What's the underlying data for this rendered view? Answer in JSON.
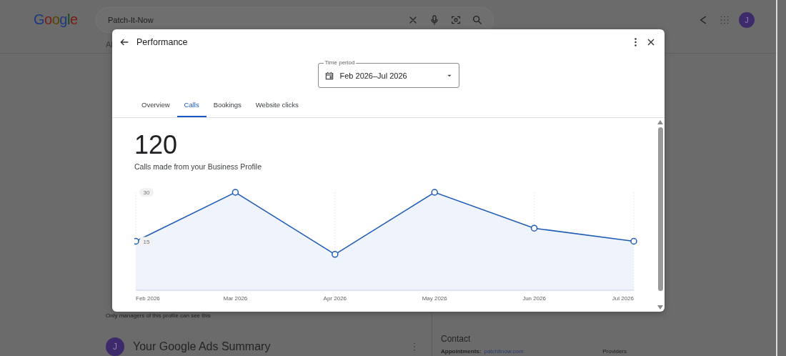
{
  "page": {
    "logo": "Google",
    "search": {
      "value": "Patch-It-Now"
    },
    "avatar": "J",
    "nav": [
      "Al"
    ],
    "managers_note": "Only managers of this profile can see this",
    "ads_summary": {
      "avatar": "J",
      "title": "Your Google Ads Summary"
    },
    "contact": {
      "title": "Contact",
      "label": "Appointments:",
      "link": "patchitnow.com",
      "providers": "Providers"
    }
  },
  "dialog": {
    "title": "Performance",
    "time_period": {
      "label": "Time period",
      "value": "Feb 2026–Jul 2026"
    },
    "tabs": [
      {
        "label": "Overview",
        "selected": false
      },
      {
        "label": "Calls",
        "selected": true
      },
      {
        "label": "Bookings",
        "selected": false
      },
      {
        "label": "Website clicks",
        "selected": false
      }
    ],
    "total": "120",
    "subtitle": "Calls made from your Business Profile",
    "chart_data": {
      "type": "area",
      "categories": [
        "Feb 2026",
        "Mar 2026",
        "Apr 2026",
        "May 2026",
        "Jun 2026",
        "Jul 2026"
      ],
      "series": [
        {
          "color": "#1f5bb5",
          "values": [
            15,
            30,
            11,
            30,
            19,
            15
          ]
        }
      ],
      "ylim": [
        0,
        30
      ],
      "yticks": [
        15,
        30
      ]
    }
  }
}
